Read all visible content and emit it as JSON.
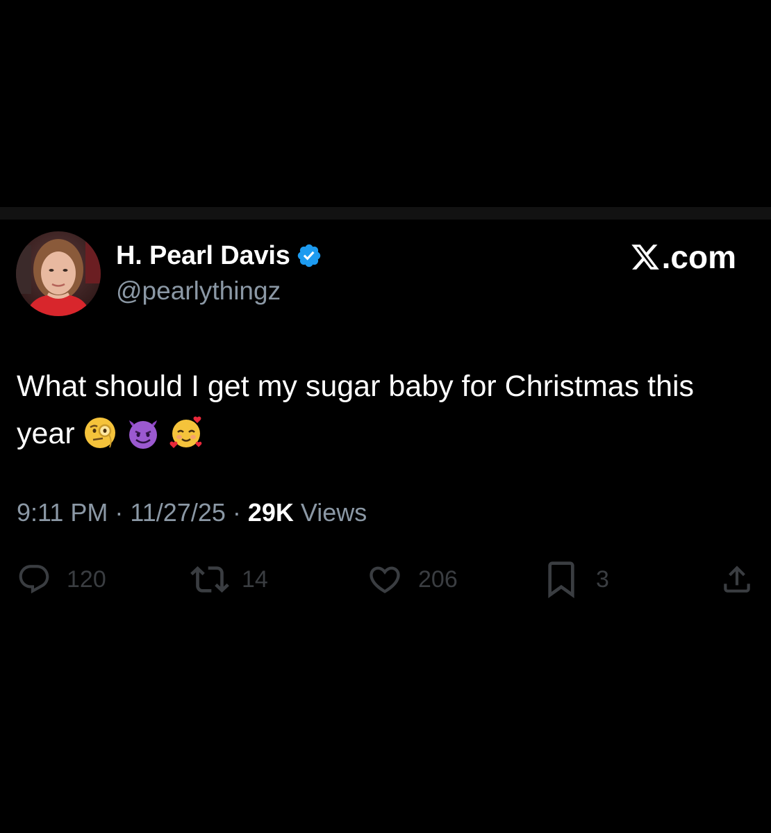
{
  "author": {
    "display_name": "H. Pearl Davis",
    "handle": "@pearlythingz",
    "verified": true,
    "avatar_icon": "profile-photo"
  },
  "brand": {
    "logo_icon": "x-logo-icon",
    "suffix": ".com"
  },
  "tweet": {
    "text": "What should I get my sugar baby for Christmas this year",
    "emojis": [
      "face-with-monocle",
      "smiling-face-with-horns",
      "smiling-face-with-hearts"
    ]
  },
  "meta": {
    "time": "9:11 PM",
    "sep1": " · ",
    "date": "11/27/25",
    "sep2": " · ",
    "views_count": "29K",
    "views_label": " Views"
  },
  "actions": {
    "replies": "120",
    "reposts": "14",
    "likes": "206",
    "bookmarks": "3"
  },
  "colors": {
    "background": "#000000",
    "text_primary": "#ffffff",
    "text_secondary": "#8b98a5",
    "verified_blue": "#1d9bf0",
    "action_icons": "#3a3d41",
    "divider": "#121212"
  }
}
